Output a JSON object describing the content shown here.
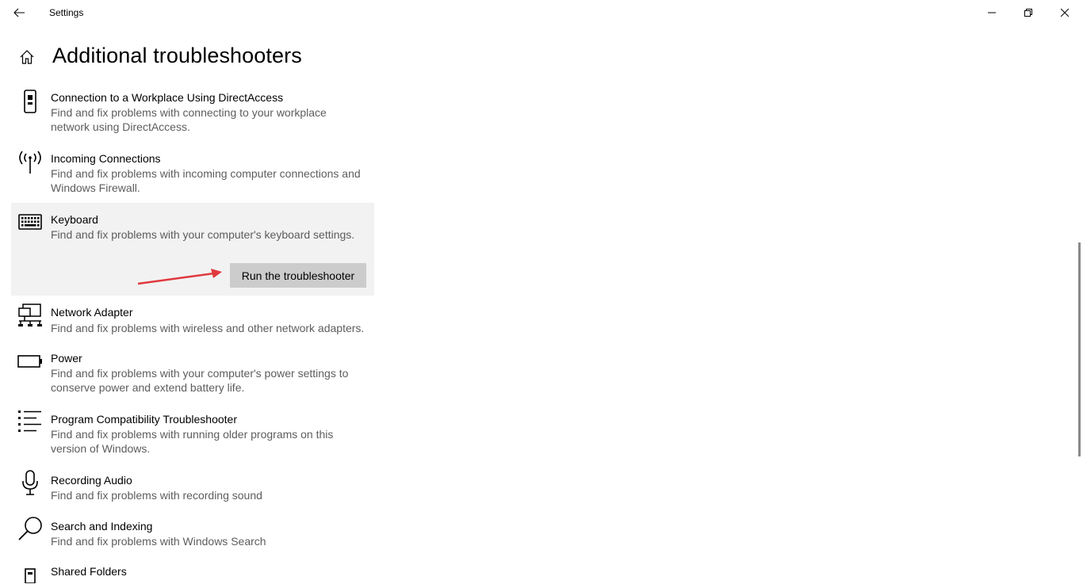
{
  "window": {
    "title": "Settings",
    "controls": {
      "minimize": "minimize-icon",
      "maximize": "restore-icon",
      "close": "close-icon"
    }
  },
  "page": {
    "title": "Additional troubleshooters"
  },
  "items": [
    {
      "icon": "phone-device-icon",
      "name": "Connection to a Workplace Using DirectAccess",
      "desc_line1": "Find and fix problems with connecting to your workplace",
      "desc_line2": "network using DirectAccess."
    },
    {
      "icon": "antenna-icon",
      "name": "Incoming Connections",
      "desc_line1": "Find and fix problems with incoming computer connections and",
      "desc_line2": "Windows Firewall."
    },
    {
      "icon": "keyboard-icon",
      "name": "Keyboard",
      "desc_line1": "Find and fix problems with your computer's keyboard settings.",
      "desc_line2": "",
      "button": "Run the troubleshooter"
    },
    {
      "icon": "network-adapter-icon",
      "name": "Network Adapter",
      "desc_line1": "Find and fix problems with wireless and other network adapters.",
      "desc_line2": ""
    },
    {
      "icon": "battery-icon",
      "name": "Power",
      "desc_line1": "Find and fix problems with your computer's power settings to",
      "desc_line2": "conserve power and extend battery life."
    },
    {
      "icon": "list-icon",
      "name": "Program Compatibility Troubleshooter",
      "desc_line1": "Find and fix problems with running older programs on this",
      "desc_line2": "version of Windows."
    },
    {
      "icon": "microphone-icon",
      "name": "Recording Audio",
      "desc_line1": "Find and fix problems with recording sound",
      "desc_line2": ""
    },
    {
      "icon": "search-icon",
      "name": "Search and Indexing",
      "desc_line1": "Find and fix problems with Windows Search",
      "desc_line2": ""
    },
    {
      "icon": "shared-folder-icon",
      "name": "Shared Folders",
      "desc_line1": "",
      "desc_line2": ""
    }
  ],
  "colors": {
    "selected_bg": "#f2f2f2",
    "button_bg": "#cccccc",
    "arrow": "#e0393e",
    "desc_text": "#5d5d5d"
  }
}
